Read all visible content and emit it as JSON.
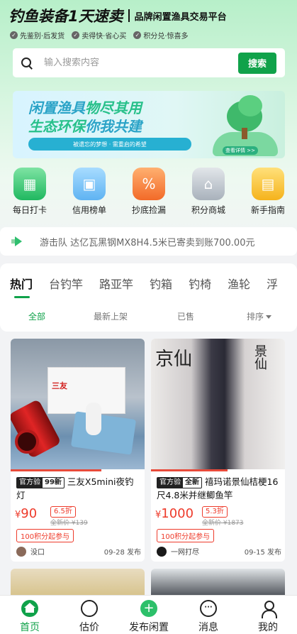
{
  "header": {
    "brand": "钓鱼装备1天速卖",
    "slogan": "品牌闲置渔具交易平台",
    "badges": [
      "先鉴别·后发货",
      "卖得快·省心买",
      "积分兑·惊喜多"
    ]
  },
  "search": {
    "placeholder": "输入搜索内容",
    "button_label": "搜索"
  },
  "banner": {
    "line1_a": "闲置渔具",
    "line1_b": "物尽其用",
    "line2_a": "生态环保",
    "line2_b": "你我共建",
    "pill": "被遗忘的梦想 · 需重启的希望",
    "more": "查看详情 >>"
  },
  "categories": [
    {
      "label": "每日打卡",
      "icon": "calendar-icon",
      "color": "#20b860"
    },
    {
      "label": "信用榜单",
      "icon": "box-icon",
      "color": "#5fb3f2"
    },
    {
      "label": "抄底捡漏",
      "icon": "discount-icon",
      "color": "#f26a28"
    },
    {
      "label": "积分商城",
      "icon": "shop-icon",
      "color": "#a8b1bb"
    },
    {
      "label": "新手指南",
      "icon": "book-icon",
      "color": "#f5b31c"
    }
  ],
  "notice": {
    "text": "游击队 达亿瓦黑钢MX8H4.5米已寄卖到账700.00元"
  },
  "tabs": [
    "热门",
    "台钓竿",
    "路亚竿",
    "钓箱",
    "钓椅",
    "渔轮",
    "浮"
  ],
  "sub_tabs": {
    "all": "全部",
    "latest": "最新上架",
    "sold": "已售",
    "sort": "排序"
  },
  "products": [
    {
      "official": "官方验",
      "grade": "99新",
      "title": "三友X5mini夜钓灯",
      "price_symbol": "¥",
      "price": "90",
      "discount": "6.5折",
      "orig": "全新价 ¥139",
      "points": "100积分起参与",
      "seller": "没口",
      "date": "09-28 发布",
      "box_text": "三友"
    },
    {
      "official": "官方验",
      "grade": "全新",
      "title": "禧玛诺景仙桔梗16尺4.8米并继鲫鱼竿",
      "price_symbol": "¥",
      "price": "1000",
      "discount": "5.3折",
      "orig": "全新价 ¥1873",
      "points": "100积分起参与",
      "seller": "一网打尽",
      "date": "09-15 发布",
      "scroll_left": "京仙",
      "scroll_right": "景仙"
    }
  ],
  "nav": [
    {
      "label": "首页",
      "icon": "home-icon",
      "active": true
    },
    {
      "label": "估价",
      "icon": "estimate-icon",
      "active": false
    },
    {
      "label": "发布闲置",
      "icon": "plus-icon",
      "active": false
    },
    {
      "label": "消息",
      "icon": "chat-icon",
      "active": false
    },
    {
      "label": "我的",
      "icon": "user-icon",
      "active": false
    }
  ],
  "colors": {
    "accent": "#10a24a",
    "price": "#ee3b2b"
  }
}
